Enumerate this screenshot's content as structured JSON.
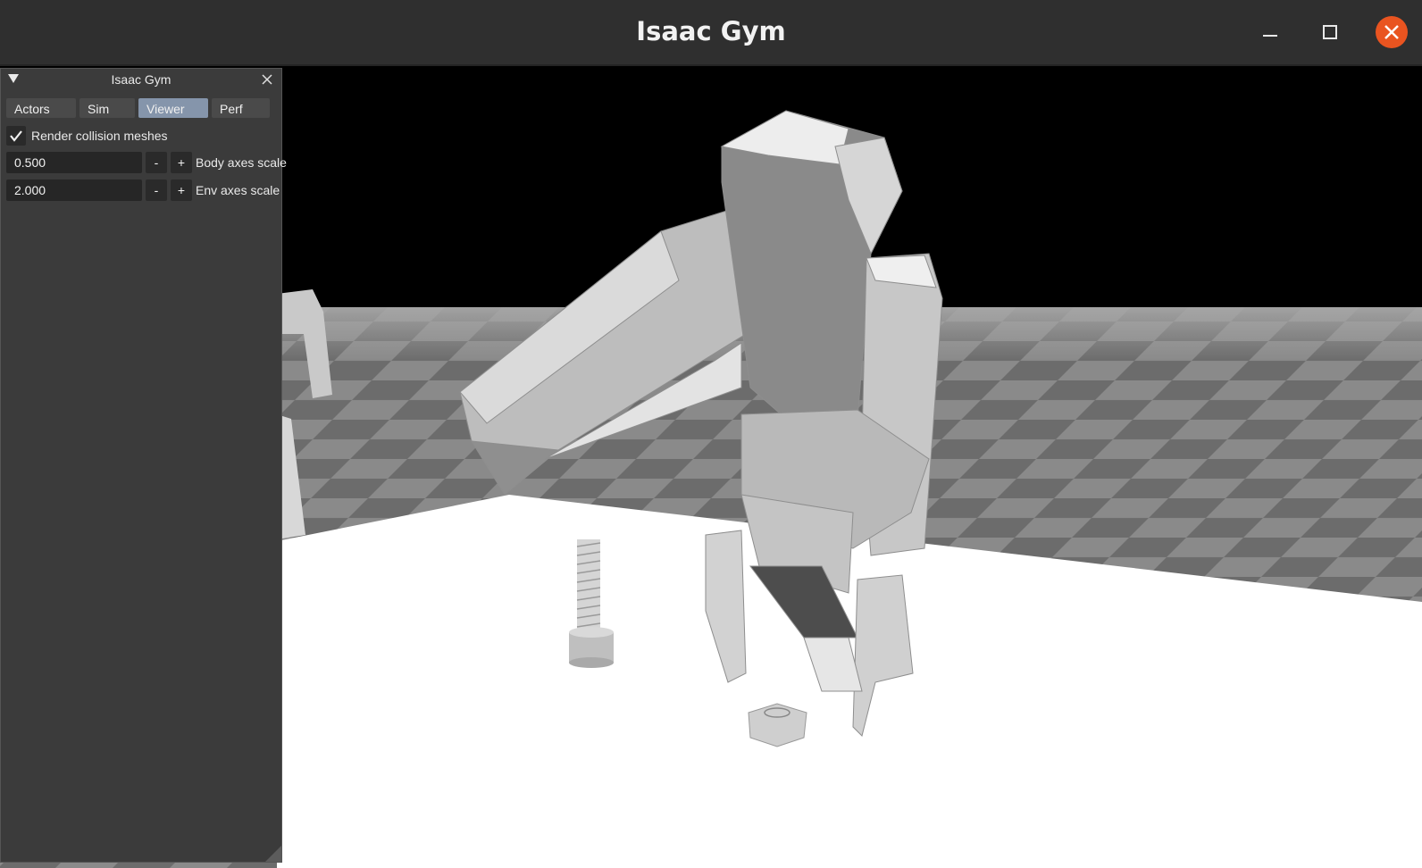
{
  "window": {
    "title": "Isaac Gym",
    "accent": "#e95420"
  },
  "panel": {
    "title": "Isaac Gym",
    "tabs": [
      {
        "label": "Actors",
        "active": false
      },
      {
        "label": "Sim",
        "active": false
      },
      {
        "label": "Viewer",
        "active": true
      },
      {
        "label": "Perf",
        "active": false
      }
    ],
    "render_collision": {
      "label": "Render collision meshes",
      "checked": true
    },
    "body_axes": {
      "value": "0.500",
      "minus": "-",
      "plus": "+",
      "label": "Body axes scale"
    },
    "env_axes": {
      "value": "2.000",
      "minus": "-",
      "plus": "+",
      "label": "Env axes scale"
    }
  },
  "colors": {
    "tab_active": "#8595ab",
    "floor_light": "#8a8a8a",
    "floor_dark": "#6a6a6a",
    "table": "#ffffff"
  }
}
